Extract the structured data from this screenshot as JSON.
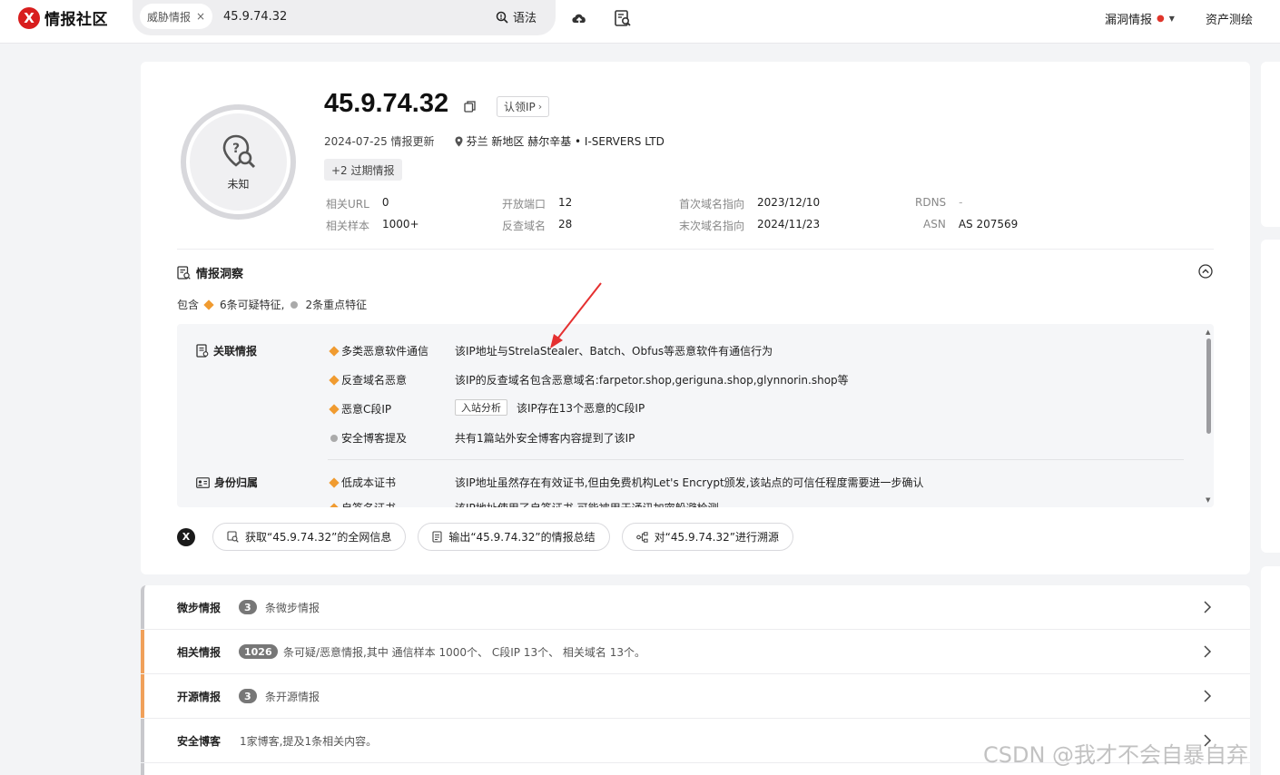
{
  "app": {
    "logo_mark": "X",
    "logo_text": "情报社区"
  },
  "search": {
    "tag": "威胁情报",
    "tag_close": "×",
    "value": "45.9.74.32",
    "syntax_label": "语法"
  },
  "nav": {
    "vuln_intel": "漏洞情报",
    "asset_map": "资产测绘",
    "icons": [
      "cloud-upload-icon",
      "report-search-icon"
    ]
  },
  "profile": {
    "ip": "45.9.74.32",
    "claim_label": "认领IP",
    "status": "未知",
    "updated": "2024-07-25 情报更新",
    "location": "芬兰 新地区 赫尔辛基 • I-SERVERS LTD",
    "past_label": "+2 过期情报"
  },
  "stats": [
    {
      "key": "相关URL",
      "value": "0"
    },
    {
      "key": "相关样本",
      "value": "1000+"
    },
    {
      "key": "开放端口",
      "value": "12"
    },
    {
      "key": "反查域名",
      "value": "28"
    },
    {
      "key": "首次域名指向",
      "value": "2023/12/10"
    },
    {
      "key": "末次域名指向",
      "value": "2024/11/23"
    },
    {
      "key": "RDNS",
      "value": "-"
    },
    {
      "key": "ASN",
      "value": "AS 207569"
    }
  ],
  "insight": {
    "title": "情报洞察",
    "contains_prefix": "包含",
    "suspicious": "6条可疑特征,",
    "key_features": "2条重点特征",
    "groups": [
      {
        "title": "关联情报",
        "items": [
          {
            "feature": "多类恶意软件通信",
            "desc": "该IP地址与StrelaStealer、Batch、Obfus等恶意软件有通信行为"
          },
          {
            "feature": "反查域名恶意",
            "desc": "该IP的反查域名包含恶意域名:farpetor.shop,geriguna.shop,glynnorin.shop等"
          },
          {
            "feature": "恶意C段IP",
            "button": "入站分析",
            "desc": "该IP存在13个恶意的C段IP"
          },
          {
            "feature": "安全博客提及",
            "desc": "共有1篇站外安全博客内容提到了该IP"
          }
        ]
      },
      {
        "title": "身份归属",
        "items": [
          {
            "feature": "低成本证书",
            "desc": "该IP地址虽然存在有效证书,但由免费机构Let's Encrypt颁发,该站点的可信任程度需要进一步确认"
          },
          {
            "feature": "自签名证书",
            "desc": "该IP地址使用了自签证书,可能被用于通讯加密躲避检测"
          }
        ]
      }
    ]
  },
  "actions": {
    "badge": "X",
    "fetch": "获取“45.9.74.32”的全网信息",
    "export": "输出“45.9.74.32”的情报总结",
    "trace": "对“45.9.74.32”进行溯源"
  },
  "sections": [
    {
      "name": "微步情报",
      "count": "3",
      "text": "条微步情报"
    },
    {
      "name": "相关情报",
      "count": "1026",
      "text": "条可疑/恶意情报,其中 通信样本 1000个、 C段IP 13个、 相关域名 13个。"
    },
    {
      "name": "开源情报",
      "count": "3",
      "text": "条开源情报"
    },
    {
      "name": "安全博客",
      "text": "1家博客,提及1条相关内容。"
    }
  ],
  "watermark": "CSDN @我才不会自暴自弃",
  "colors": {
    "brand": "#d81e1e",
    "suspicious": "#f09b30",
    "key": "#aaaaaa",
    "arrow": "#e53030"
  }
}
